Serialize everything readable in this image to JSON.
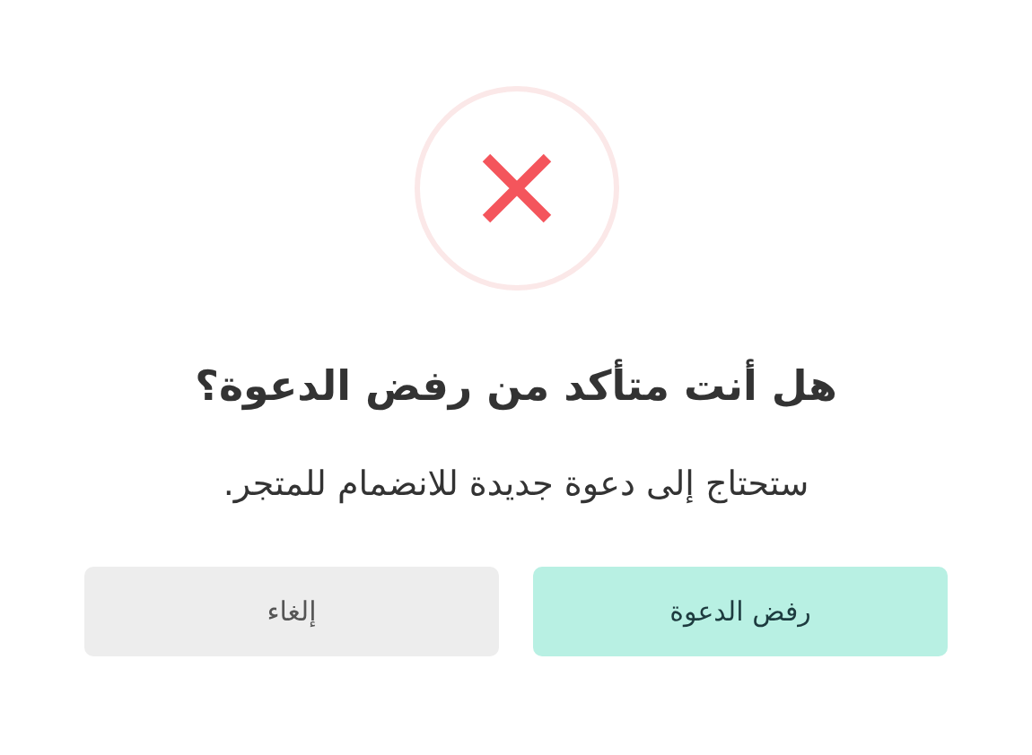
{
  "dialog": {
    "title": "هل أنت متأكد من رفض الدعوة؟",
    "message": "ستحتاج إلى دعوة جديدة للانضمام للمتجر.",
    "buttons": [
      {
        "label": "رفض الدعوة",
        "kind": "primary"
      },
      {
        "label": "إلغاء",
        "kind": "secondary"
      }
    ]
  }
}
